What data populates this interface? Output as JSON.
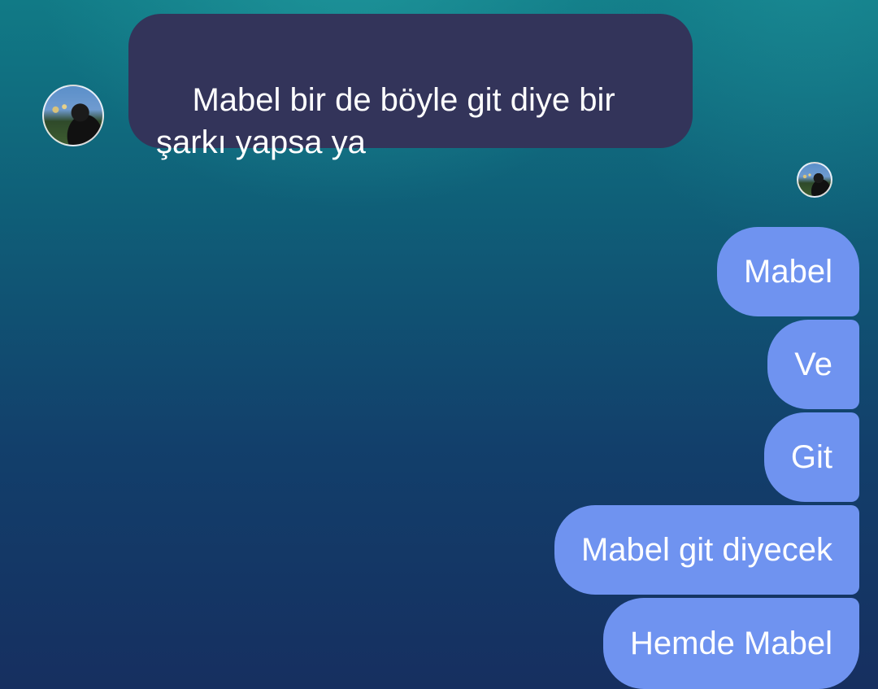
{
  "conversation": {
    "incoming": {
      "text": "Mabel bir de böyle git diye bir\nşarkı yapsa ya",
      "bubble_color": "#33345a",
      "avatar_icon": "profile-photo-icon"
    },
    "read_receipt_icon": "profile-photo-icon",
    "outgoing": [
      {
        "text": "Mabel"
      },
      {
        "text": "Ve"
      },
      {
        "text": "Git"
      },
      {
        "text": "Mabel git diyecek"
      },
      {
        "text": "Hemde Mabel"
      }
    ],
    "outgoing_bubble_color": "#6f93f0"
  }
}
